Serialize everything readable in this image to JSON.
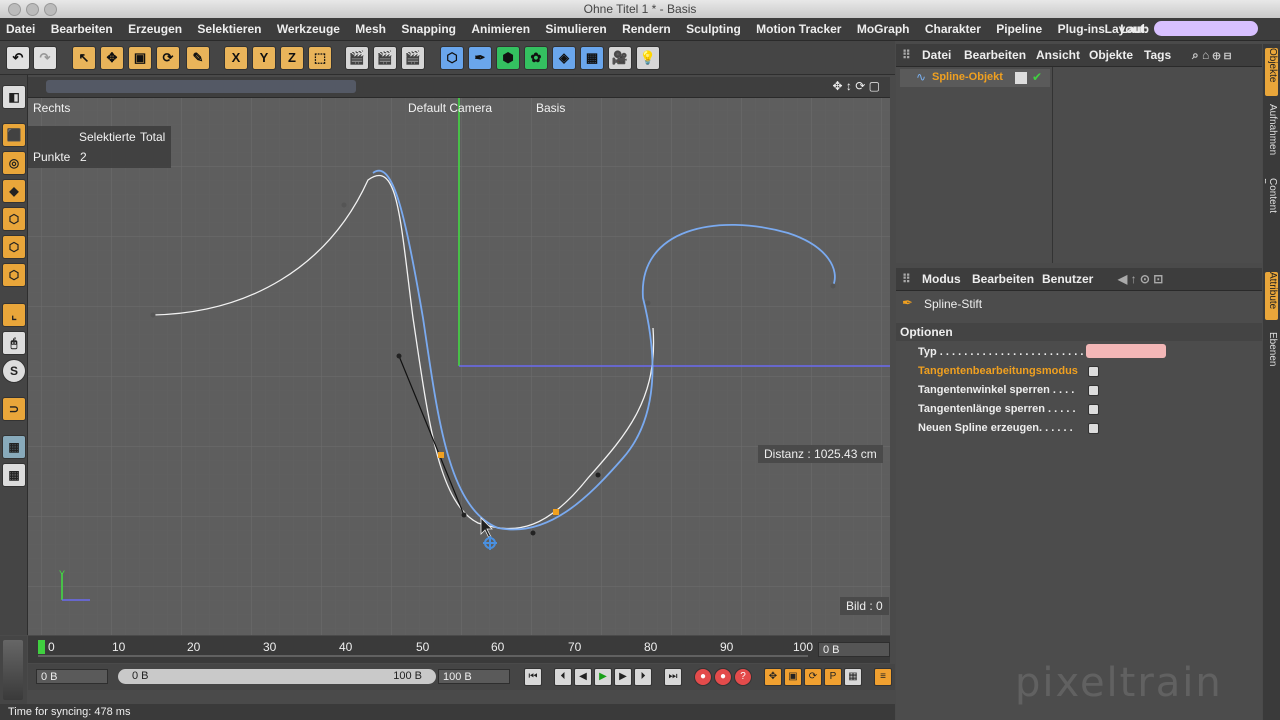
{
  "window": {
    "title": "Ohne Titel 1 * - Basis"
  },
  "menu": {
    "items": [
      "Datei",
      "Bearbeiten",
      "Erzeugen",
      "Selektieren",
      "Werkzeuge",
      "Mesh",
      "Snapping",
      "Animieren",
      "Simulieren",
      "Rendern",
      "Sculpting",
      "Motion Tracker",
      "MoGraph",
      "Charakter",
      "Pipeline",
      "Plug-ins",
      "Laub"
    ],
    "layout_label": "Layout:"
  },
  "toolbar": {
    "undo_icon": "undo-icon",
    "redo_icon": "redo-icon",
    "axis_x": "X",
    "axis_y": "Y",
    "axis_z": "Z"
  },
  "viewport": {
    "view_name": "Rechts",
    "camera": "Default Camera",
    "display_mode": "Basis",
    "info": {
      "col_selected": "Selektierte",
      "col_total": "Total",
      "row_label": "Punkte",
      "row_value": "2"
    },
    "distance": "Distanz : 1025.43 cm",
    "frame": "Bild : 0",
    "colors": {
      "spline": "#f2f2f2",
      "spline_blue": "#7aaaf0",
      "axis_green": "#40e040",
      "axis_blue": "#6a6af0",
      "handle": "#f0a020"
    }
  },
  "timeline": {
    "ticks": [
      "0",
      "10",
      "20",
      "30",
      "40",
      "50",
      "60",
      "70",
      "80",
      "90",
      "100"
    ],
    "current_frame": "0 B"
  },
  "controls": {
    "start": "0 B",
    "range_start": "0 B",
    "range_end": "100 B",
    "end": "100 B"
  },
  "status": {
    "text": "Time for syncing: 478 ms"
  },
  "objects_panel": {
    "menu": [
      "Datei",
      "Bearbeiten",
      "Ansicht",
      "Objekte",
      "Tags"
    ],
    "object_name": "Spline-Objekt"
  },
  "attributes_panel": {
    "menu": [
      "Modus",
      "Bearbeiten",
      "Benutzer"
    ],
    "tool_name": "Spline-Stift",
    "section": "Optionen",
    "rows": [
      {
        "label": "Typ . . . . . . . . . . . . . . . . . . . . . . . . . ."
      },
      {
        "label": "Tangentenbearbeitungsmodus",
        "highlight": true
      },
      {
        "label": "Tangentenwinkel sperren . . . ."
      },
      {
        "label": "Tangentenlänge sperren . . . . ."
      },
      {
        "label": "Neuen Spline erzeugen. . . . . ."
      }
    ]
  },
  "right_tabs": [
    "Objekte",
    "Aufnahmen",
    "Content Browser",
    "Attribute",
    "Ebenen"
  ],
  "watermark": "pixeltrain"
}
